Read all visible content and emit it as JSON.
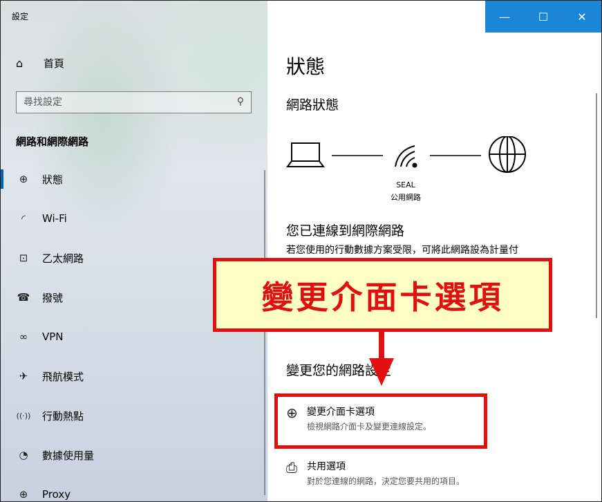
{
  "window": {
    "title": "設定"
  },
  "controls": {
    "minimize": "—",
    "maximize": "☐",
    "close": "✕"
  },
  "sidebar": {
    "home_label": "首頁",
    "search_placeholder": "尋找設定",
    "section_title": "網路和網際網路",
    "items": [
      {
        "label": "狀態",
        "icon": "globe-icon",
        "glyph": "⊕",
        "active": true
      },
      {
        "label": "Wi-Fi",
        "icon": "wifi-icon",
        "glyph": "◜"
      },
      {
        "label": "乙太網路",
        "icon": "ethernet-icon",
        "glyph": "⊡"
      },
      {
        "label": "撥號",
        "icon": "dialup-icon",
        "glyph": "☎"
      },
      {
        "label": "VPN",
        "icon": "vpn-icon",
        "glyph": "∞"
      },
      {
        "label": "飛航模式",
        "icon": "airplane-icon",
        "glyph": "✈"
      },
      {
        "label": "行動熱點",
        "icon": "hotspot-icon",
        "glyph": "((·))"
      },
      {
        "label": "數據使用量",
        "icon": "data-usage-icon",
        "glyph": "◔"
      },
      {
        "label": "Proxy",
        "icon": "proxy-icon",
        "glyph": "⊕"
      }
    ]
  },
  "main": {
    "title": "狀態",
    "network_status_heading": "網路狀態",
    "network_name": "SEAL",
    "network_type": "公用網路",
    "connected_title": "您已連線到網際網路",
    "connected_desc": "若您使用的行動數據方案受限，可將此網路設為計量付",
    "change_settings_heading": "變更您的網路設定",
    "options": [
      {
        "title": "變更介面卡選項",
        "desc": "檢視網路介面卡及變更連線設定。",
        "icon": "adapter-icon"
      },
      {
        "title": "共用選項",
        "desc": "對於您連線的網路，決定您要共用的項目。",
        "icon": "sharing-icon"
      }
    ]
  },
  "annotation": {
    "callout_text": "變更介面卡選項",
    "color": "#e01010"
  },
  "colors": {
    "accent": "#1b86d6",
    "active_indicator": "#0063b1"
  }
}
